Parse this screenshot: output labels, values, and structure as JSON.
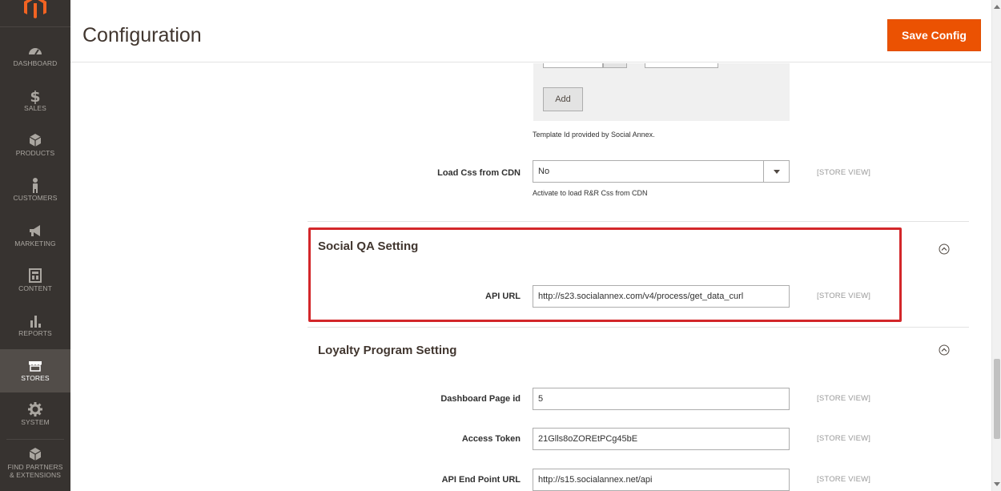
{
  "header": {
    "title": "Configuration",
    "save_label": "Save Config"
  },
  "sidebar": {
    "items": [
      {
        "label": "DASHBOARD",
        "icon": "dashboard-icon"
      },
      {
        "label": "SALES",
        "icon": "dollar-icon"
      },
      {
        "label": "PRODUCTS",
        "icon": "box-icon"
      },
      {
        "label": "CUSTOMERS",
        "icon": "person-icon"
      },
      {
        "label": "MARKETING",
        "icon": "megaphone-icon"
      },
      {
        "label": "CONTENT",
        "icon": "layout-icon"
      },
      {
        "label": "REPORTS",
        "icon": "bar-chart-icon"
      },
      {
        "label": "STORES",
        "icon": "store-icon"
      },
      {
        "label": "SYSTEM",
        "icon": "gear-icon"
      },
      {
        "label": "FIND PARTNERS",
        "label2": "& EXTENSIONS",
        "icon": "partners-icon"
      }
    ]
  },
  "template": {
    "add_label": "Add",
    "note": "Template Id provided by Social Annex."
  },
  "load_css": {
    "label": "Load Css from CDN",
    "value": "No",
    "note": "Activate to load R&R Css from CDN",
    "scope": "[STORE VIEW]"
  },
  "social_qa": {
    "title": "Social QA Setting",
    "api_url_label": "API URL",
    "api_url_value": "http://s23.socialannex.com/v4/process/get_data_curl",
    "scope": "[STORE VIEW]"
  },
  "loyalty": {
    "title": "Loyalty Program Setting",
    "fields": [
      {
        "label": "Dashboard Page id",
        "value": "5",
        "scope": "[STORE VIEW]"
      },
      {
        "label": "Access Token",
        "value": "21Glls8oZOREtPCg45bE",
        "scope": "[STORE VIEW]"
      },
      {
        "label": "API End Point URL",
        "value": "http://s15.socialannex.net/api",
        "scope": "[STORE VIEW]"
      }
    ]
  },
  "colors": {
    "accent": "#eb5202",
    "sidebar": "#373330",
    "highlight": "#d3272a"
  }
}
